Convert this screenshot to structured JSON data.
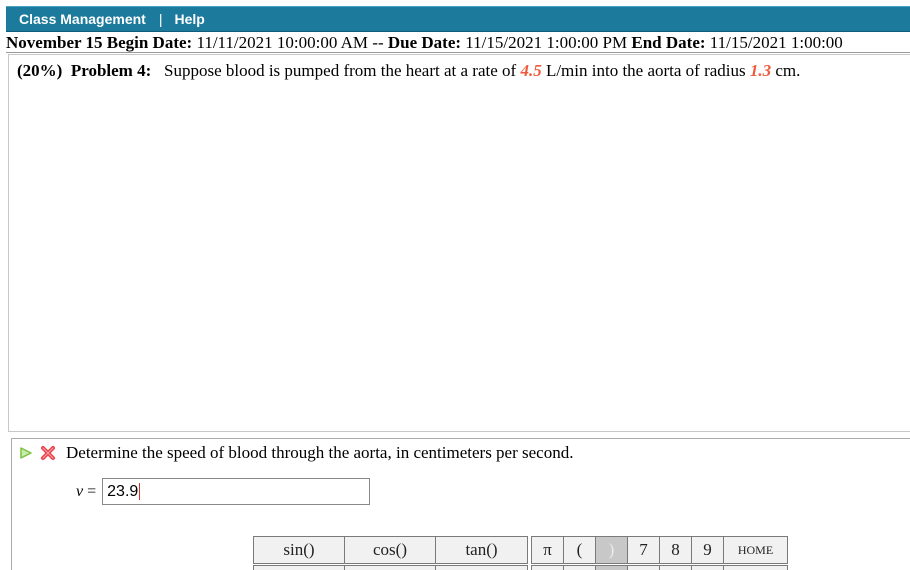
{
  "topbar": {
    "class_management": "Class Management",
    "separator": "|",
    "help": "Help"
  },
  "dates": {
    "assignment": "November 15",
    "begin_label": "Begin Date:",
    "begin_value": "11/11/2021 10:00:00 AM",
    "dash": "--",
    "due_label": "Due Date:",
    "due_value": "11/15/2021 1:00:00 PM",
    "end_label": "End Date:",
    "end_value": "11/15/2021 1:00:00"
  },
  "problem": {
    "weight": "(20%)",
    "label": "Problem 4:",
    "text_before": "Suppose blood is pumped from the heart at a rate of",
    "rate_value": "4.5",
    "text_middle": "L/min into the aorta of radius",
    "radius_value": "1.3",
    "text_after": "cm."
  },
  "part": {
    "question": "Determine the speed of blood through the aorta, in centimeters per second.",
    "answer_var": "v",
    "answer_eq": "=",
    "answer_value": "23.9"
  },
  "keypad": {
    "sin": "sin()",
    "cos": "cos()",
    "tan": "tan()",
    "pi": "π",
    "lparen": "(",
    "rparen": ")",
    "seven": "7",
    "eight": "8",
    "nine": "9",
    "home": "HOME"
  },
  "colors": {
    "header_bg": "#1c7a9c",
    "variable": "#ee5a3a",
    "status_incorrect": "#e8414b",
    "status_play": "#7cc142"
  }
}
